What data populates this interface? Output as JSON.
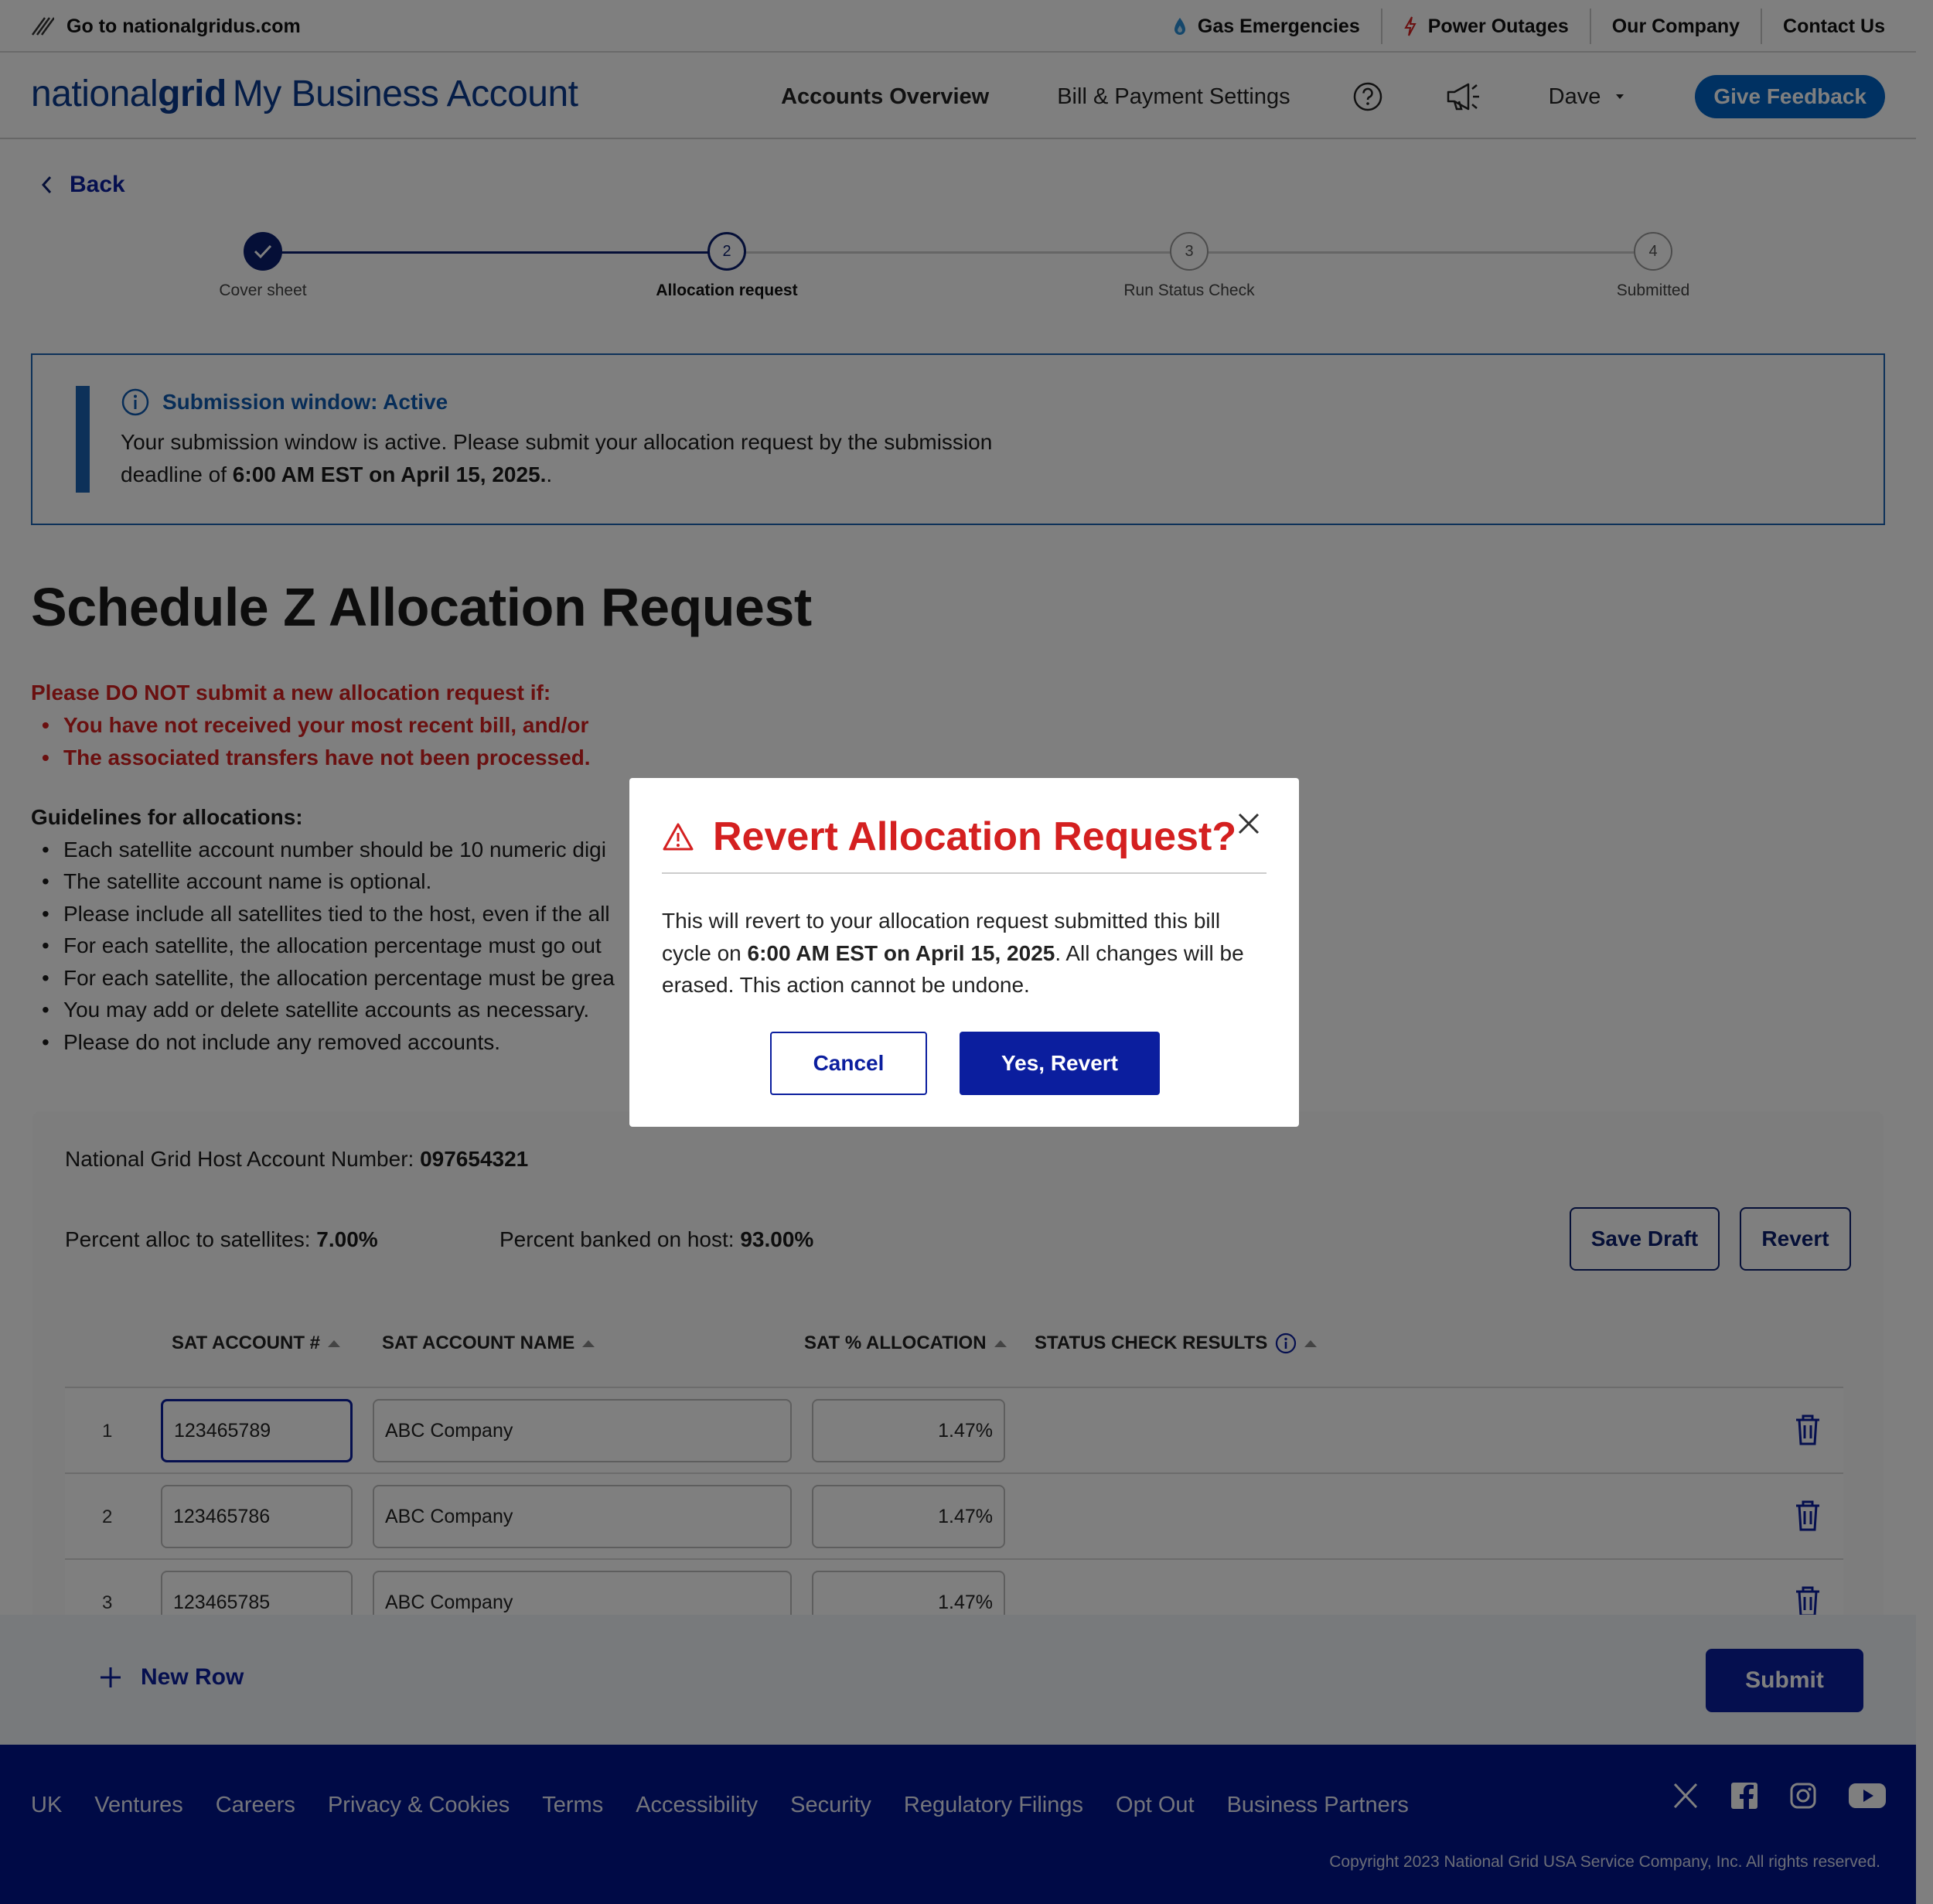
{
  "utility": {
    "goto": "Go to nationalgridus.com",
    "links": [
      {
        "label": "Gas Emergencies",
        "icon": "flame-drop-icon"
      },
      {
        "label": "Power Outages",
        "icon": "lightning-icon"
      },
      {
        "label": "Our Company"
      },
      {
        "label": "Contact Us"
      }
    ]
  },
  "nav": {
    "brand_national": "national",
    "brand_grid": "grid",
    "brand_product": "My Business Account",
    "items": [
      "Accounts Overview",
      "Bill & Payment Settings"
    ],
    "user": "Dave",
    "feedback": "Give Feedback"
  },
  "back": "Back",
  "stepper": {
    "steps": [
      {
        "num": "1",
        "label": "Cover sheet",
        "state": "done"
      },
      {
        "num": "2",
        "label": "Allocation request",
        "state": "current"
      },
      {
        "num": "3",
        "label": "Run Status Check",
        "state": "upcoming"
      },
      {
        "num": "4",
        "label": "Submitted",
        "state": "upcoming"
      }
    ]
  },
  "alert": {
    "title": "Submission window: Active",
    "text_before": "Your submission window is active. Please submit your allocation request by the submission deadline of ",
    "deadline": "6:00 AM EST on April 15, 2025.",
    "text_after": "."
  },
  "page_title": "Schedule Z Allocation Request",
  "warning": {
    "heading": "Please DO NOT submit a new allocation request if:",
    "items": [
      "You have not received your most recent bill, and/or",
      "The associated transfers have not been processed."
    ]
  },
  "guidelines": {
    "heading": "Guidelines for allocations:",
    "items": [
      "Each satellite account number should be 10 numeric digi",
      "The satellite account name is optional.",
      "Please include all satellites tied to the host, even if the all",
      "For each satellite, the allocation percentage must go out",
      "For each satellite, the allocation percentage must be grea",
      "You may add or delete satellite accounts as necessary.",
      "Please do not include any removed accounts."
    ]
  },
  "card": {
    "host_label": "National Grid Host Account Number: ",
    "host_value": "097654321",
    "pct_sat_label": "Percent alloc to satellites: ",
    "pct_sat_value": "7.00%",
    "pct_host_label": "Percent banked on host: ",
    "pct_host_value": "93.00%",
    "save_draft": "Save Draft",
    "revert": "Revert",
    "columns": [
      "SAT ACCOUNT #",
      "SAT ACCOUNT NAME",
      "SAT % ALLOCATION",
      "STATUS CHECK RESULTS"
    ],
    "rows": [
      {
        "idx": "1",
        "account": "123465789",
        "name": "ABC Company",
        "pct": "1.47%"
      },
      {
        "idx": "2",
        "account": "123465786",
        "name": "ABC Company",
        "pct": "1.47%"
      },
      {
        "idx": "3",
        "account": "123465785",
        "name": "ABC Company",
        "pct": "1.47%"
      }
    ]
  },
  "bottombar": {
    "new_row": "New Row",
    "submit": "Submit"
  },
  "footer": {
    "links": [
      "UK",
      "Ventures",
      "Careers",
      "Privacy & Cookies",
      "Terms",
      "Accessibility",
      "Security",
      "Regulatory Filings",
      "Opt Out",
      "Business Partners"
    ],
    "social": [
      "x-icon",
      "facebook-icon",
      "instagram-icon",
      "youtube-icon"
    ],
    "copyright": "Copyright 2023 National Grid USA Service Company, Inc. All rights reserved."
  },
  "modal": {
    "title": "Revert Allocation Request?",
    "body_before": "This will revert to your allocation request submitted this bill cycle on ",
    "body_bold": "6:00 AM EST on April 15, 2025",
    "body_after": ". All changes will be erased. This action cannot be undone.",
    "cancel": "Cancel",
    "confirm": "Yes, Revert"
  },
  "colors": {
    "brand_blue": "#0b1e9e",
    "alert_blue": "#1b62b3",
    "warning_red": "#d42020",
    "footer_navy": "#00148c",
    "feedback_blue": "#0062c4"
  }
}
